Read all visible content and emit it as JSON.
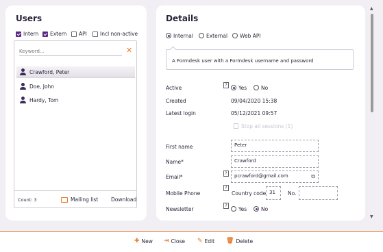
{
  "users_panel": {
    "title": "Users",
    "filters": [
      {
        "label": "Intern",
        "checked": true
      },
      {
        "label": "Extern",
        "checked": true
      },
      {
        "label": "API",
        "checked": false
      },
      {
        "label": "Incl non-active",
        "checked": false
      }
    ],
    "search": {
      "placeholder": "Keyword...",
      "value": ""
    },
    "users": [
      {
        "name": "Crawford, Peter",
        "selected": true
      },
      {
        "name": "Doe, John",
        "selected": false
      },
      {
        "name": "Hardy, Tom",
        "selected": false
      }
    ],
    "count_label": "Count: 3",
    "mailing_list_label": "Mailing list",
    "download_label": "Download"
  },
  "details_panel": {
    "title": "Details",
    "type_options": [
      {
        "label": "Internal",
        "selected": true
      },
      {
        "label": "External",
        "selected": false
      },
      {
        "label": "Web API",
        "selected": false
      }
    ],
    "type_description": "A Formdesk user with a Formdesk username and password",
    "active": {
      "label": "Active",
      "options": [
        "Yes",
        "No"
      ],
      "selected": "Yes"
    },
    "created": {
      "label": "Created",
      "value": "09/04/2020 15:38"
    },
    "latest_login": {
      "label": "Latest login",
      "value": "05/12/2021 09:57"
    },
    "stop_sessions_label": "Stop all sessions (1)",
    "first_name": {
      "label": "First name",
      "value": "Peter"
    },
    "name": {
      "label": "Name*",
      "value": "Crawford"
    },
    "email": {
      "label": "Email*",
      "value": "pcrawford@gmail.com"
    },
    "mobile": {
      "label": "Mobile Phone",
      "country_code_label": "Country code",
      "country_code": "31",
      "number_label": "No.",
      "number": ""
    },
    "newsletter": {
      "label": "Newsletter",
      "options": [
        "Yes",
        "No"
      ],
      "selected": "No"
    },
    "help_glyph": "?"
  },
  "toolbar": {
    "new_label": "New",
    "close_label": "Close",
    "edit_label": "Edit",
    "delete_label": "Delete"
  },
  "colors": {
    "accent": "#5b2a86",
    "orange": "#e8792b",
    "background": "#f1eff3"
  }
}
